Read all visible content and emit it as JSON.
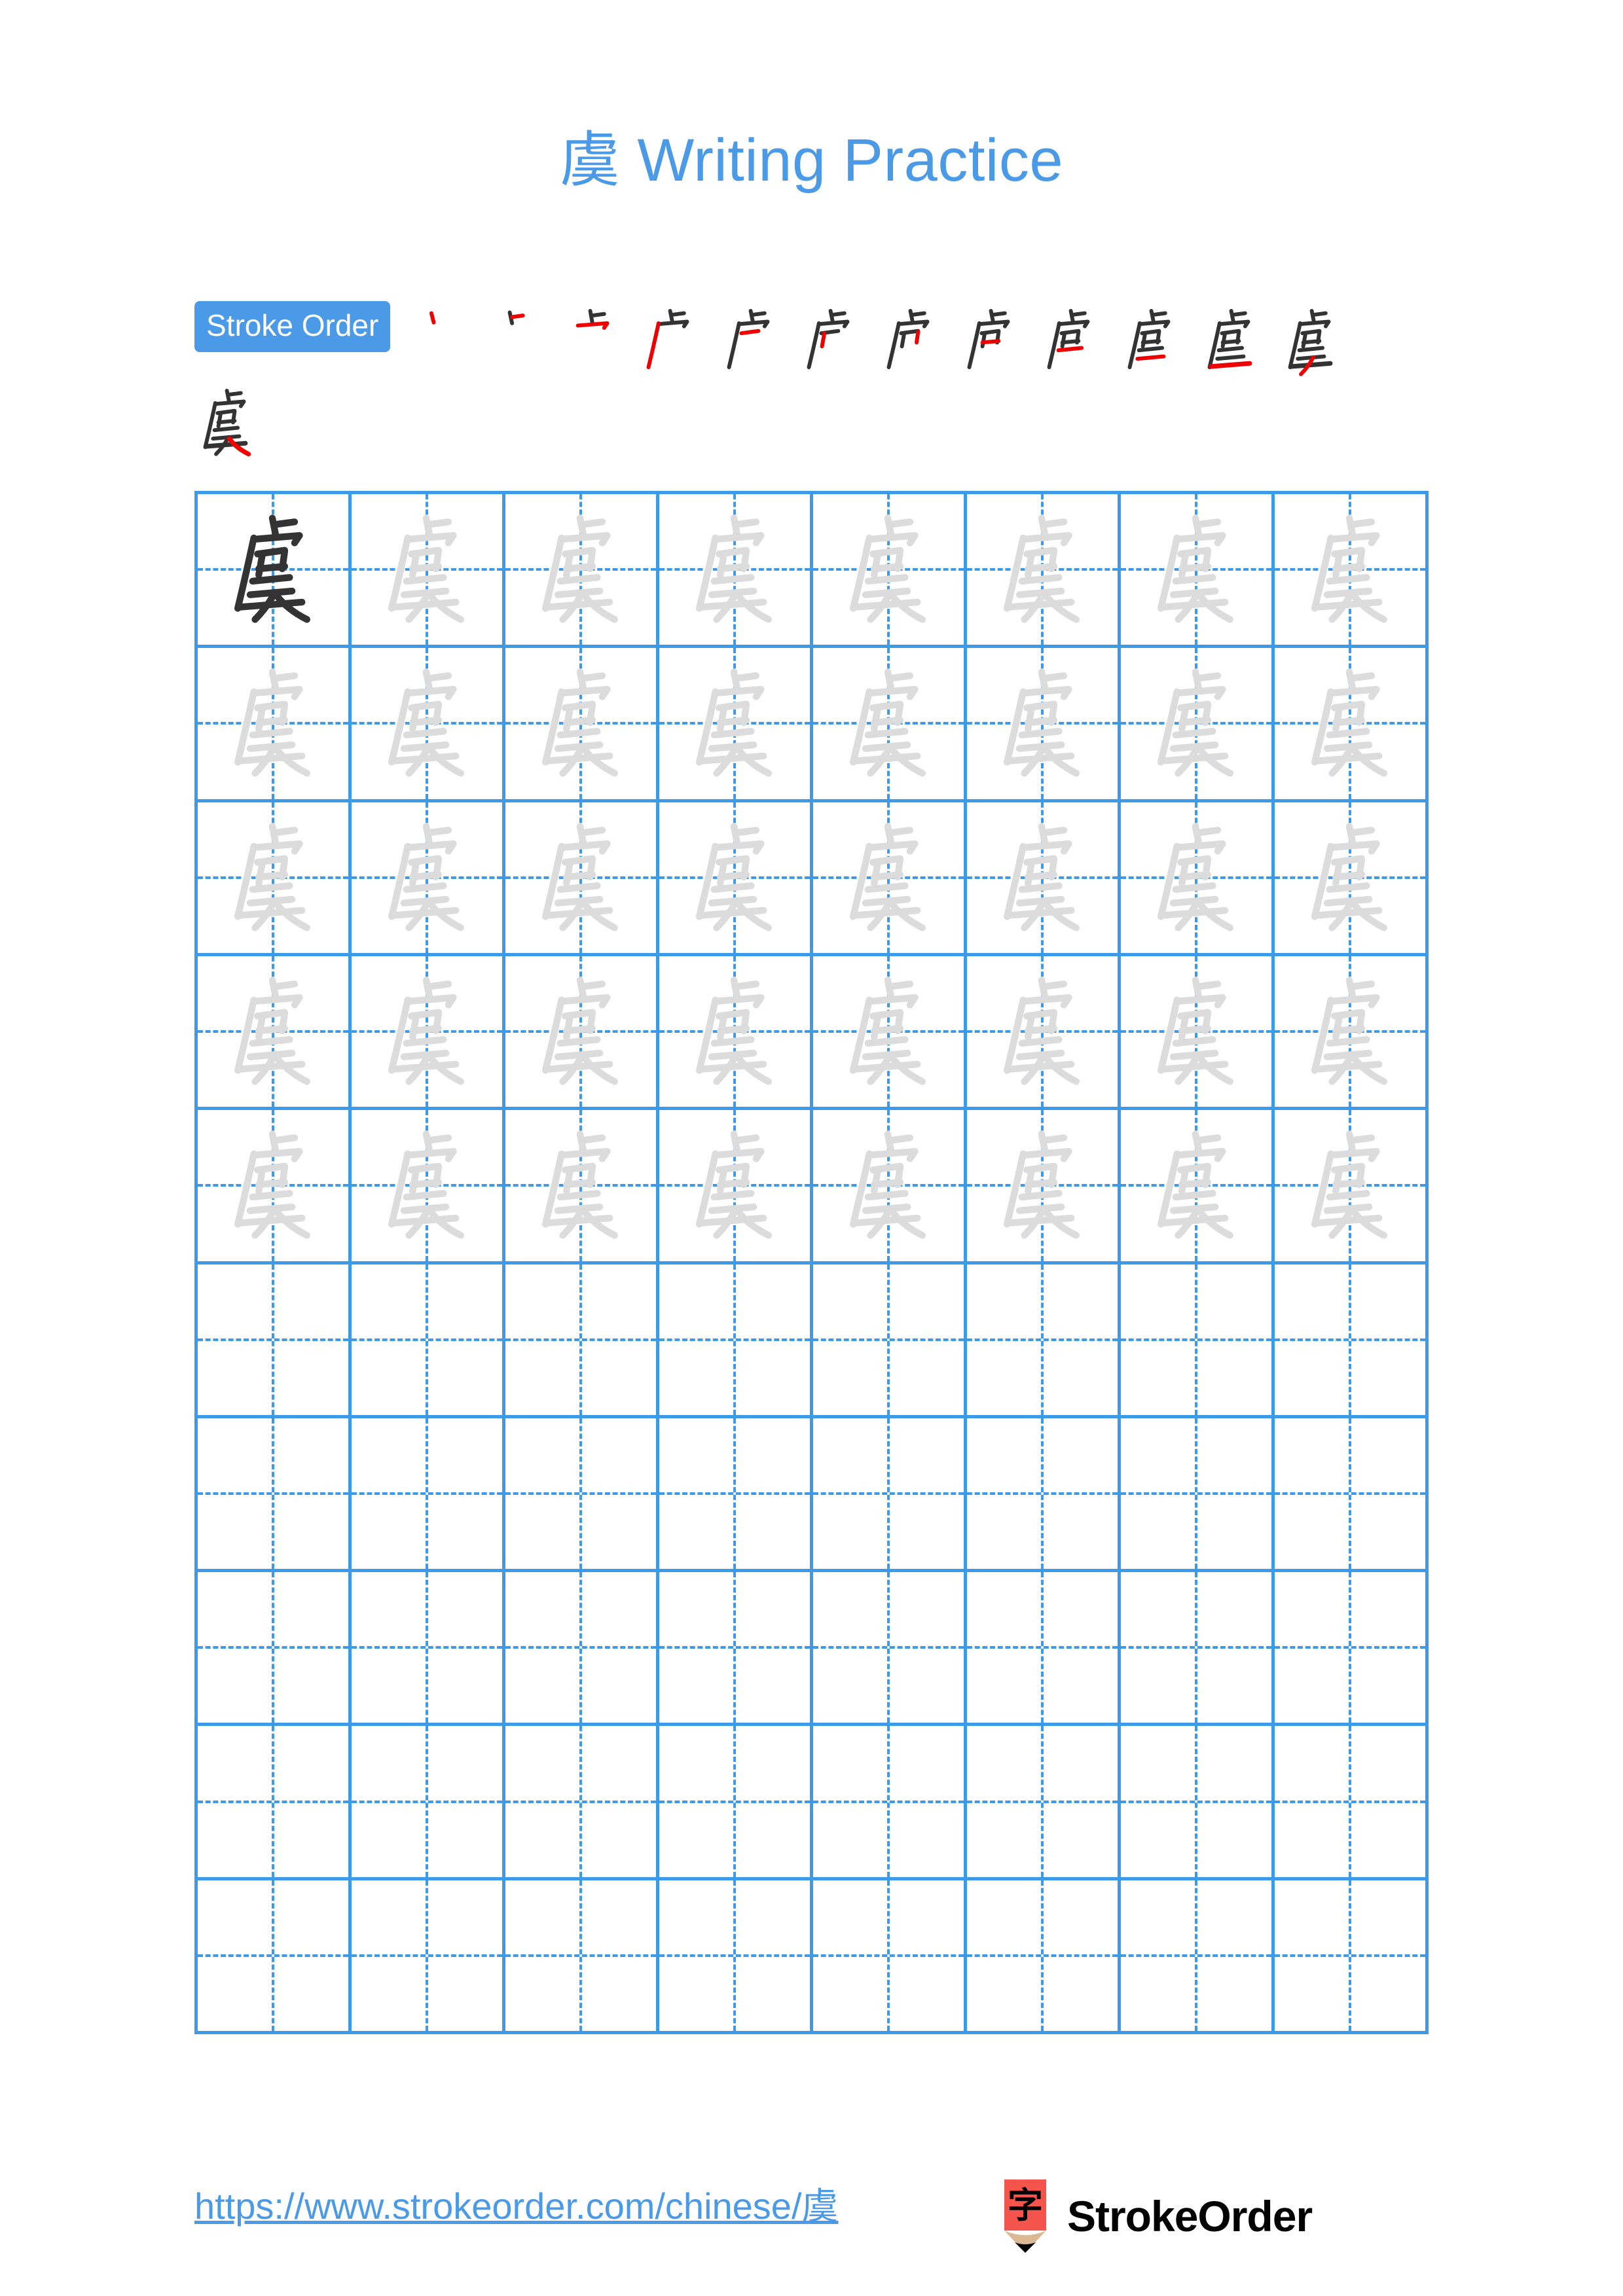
{
  "character": "虞",
  "title": "虞 Writing Practice",
  "colors": {
    "accent_blue": "#4a9ae8",
    "grid_blue": "#3c9ae8",
    "stroke_new_red": "#ee0000",
    "stroke_done_dark": "#333333",
    "trace_gray": "#dcdcdc",
    "pencil_red": "#f4544c",
    "pencil_wood": "#ddb894"
  },
  "stroke_order": {
    "badge_label": "Stroke Order",
    "total_strokes": 13,
    "steps": [
      {
        "index": 1,
        "new_stroke_name": "dian-dot"
      },
      {
        "index": 2,
        "new_stroke_name": "heng-horizontal"
      },
      {
        "index": 3,
        "new_stroke_name": "heng-horizontal"
      },
      {
        "index": 4,
        "new_stroke_name": "pie-left-falling"
      },
      {
        "index": 5,
        "new_stroke_name": "heng-horizontal"
      },
      {
        "index": 6,
        "new_stroke_name": "shu-vertical"
      },
      {
        "index": 7,
        "new_stroke_name": "shu-vertical"
      },
      {
        "index": 8,
        "new_stroke_name": "heng-zhe"
      },
      {
        "index": 9,
        "new_stroke_name": "heng-horizontal"
      },
      {
        "index": 10,
        "new_stroke_name": "heng-horizontal"
      },
      {
        "index": 11,
        "new_stroke_name": "heng-horizontal"
      },
      {
        "index": 12,
        "new_stroke_name": "pie-left-falling"
      },
      {
        "index": 13,
        "new_stroke_name": "na-right-falling"
      }
    ]
  },
  "practice_grid": {
    "columns": 8,
    "rows": 10,
    "filled_rows": 5,
    "empty_rows": 5,
    "first_cell_style": "dark",
    "trace_cell_style": "light",
    "cell_character": "虞"
  },
  "footer": {
    "url": "https://www.strokeorder.com/chinese/虞",
    "brand_name": "StrokeOrder",
    "brand_icon_glyph": "字"
  }
}
